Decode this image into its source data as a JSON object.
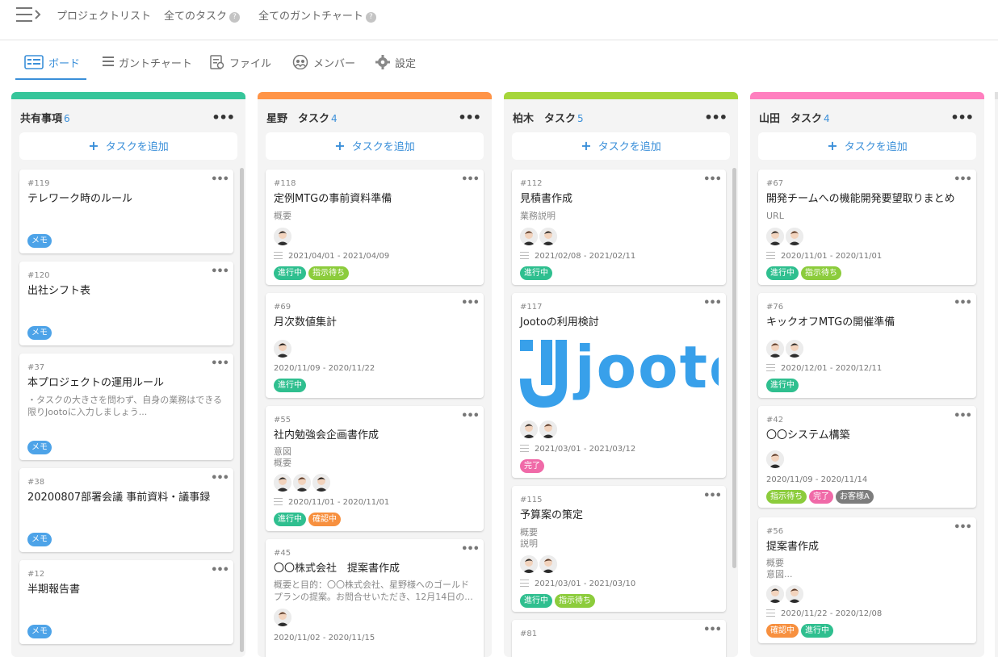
{
  "topnav": {
    "project_list": "プロジェクトリスト",
    "all_tasks": "全てのタスク",
    "all_gantt": "全てのガントチャート",
    "help_icon": "?"
  },
  "tabs": [
    {
      "label": "ボード",
      "active": true,
      "icon": "board-icon"
    },
    {
      "label": "ガントチャート",
      "icon": "gantt-icon"
    },
    {
      "label": "ファイル",
      "icon": "file-icon"
    },
    {
      "label": "メンバー",
      "icon": "member-icon"
    },
    {
      "label": "設定",
      "icon": "gear-icon"
    }
  ],
  "add_task_label": "タスクを追加",
  "more_label": "•••",
  "colors": {
    "accent": "#3a8fd9",
    "col1": "#36c59a",
    "col2": "#ff9447",
    "col3": "#a6d63a",
    "col4": "#ff7fbf"
  },
  "columns": [
    {
      "name": "共有事項",
      "count": "6",
      "cards": [
        {
          "id": "#119",
          "title": "テレワーク時のルール",
          "tags": [
            "メモ"
          ]
        },
        {
          "id": "#120",
          "title": "出社シフト表",
          "tags": [
            "メモ"
          ]
        },
        {
          "id": "#37",
          "title": "本プロジェクトの運用ルール",
          "desc1": "・タスクの大きさを問わず、自身の業務はできる",
          "desc2": "限りJootoに入力しましょう...",
          "tags": [
            "メモ"
          ]
        },
        {
          "id": "#38",
          "title": "20200807部署会議 事前資料・議事録",
          "tags": [
            "メモ"
          ]
        },
        {
          "id": "#12",
          "title": "半期報告書",
          "tags": [
            "メモ"
          ]
        }
      ]
    },
    {
      "name": "星野　タスク",
      "count": "4",
      "cards": [
        {
          "id": "#118",
          "title": "定例MTGの事前資料準備",
          "desc1": "概要",
          "date": "2021/04/01 - 2021/04/09",
          "tags": [
            "進行中",
            "指示待ち"
          ]
        },
        {
          "id": "#69",
          "title": "月次数値集計",
          "date": "2020/11/09 - 2020/11/22",
          "tags": [
            "進行中"
          ]
        },
        {
          "id": "#55",
          "title": "社内勉強会企画書作成",
          "desc1": "意図",
          "desc2": "概要",
          "date": "2020/11/01 - 2020/11/01",
          "tags": [
            "進行中",
            "確認中"
          ]
        },
        {
          "id": "#45",
          "title": "〇〇株式会社　提案書作成",
          "desc1": "概要と目的：〇〇株式会社、星野様へのゴールド",
          "desc2": "プランの提案。お問合せいただき、12月14日の...",
          "date": "2020/11/02 - 2020/11/15"
        }
      ]
    },
    {
      "name": "柏木　タスク",
      "count": "5",
      "cards": [
        {
          "id": "#112",
          "title": "見積書作成",
          "desc1": "業務説明",
          "date": "2021/02/08 - 2021/02/11",
          "tags": [
            "進行中"
          ]
        },
        {
          "id": "#117",
          "title": "Jootoの利用検討",
          "logo_text": "jooto",
          "date": "2021/03/01 - 2021/03/12",
          "tags": [
            "完了"
          ]
        },
        {
          "id": "#115",
          "title": "予算案の策定",
          "desc1": "概要",
          "desc2": "説明",
          "date": "2021/03/01 - 2021/03/10",
          "tags": [
            "進行中",
            "指示待ち"
          ]
        },
        {
          "id": "#81"
        }
      ]
    },
    {
      "name": "山田　タスク",
      "count": "4",
      "cards": [
        {
          "id": "#67",
          "title": "開発チームへの機能開発要望取りまとめ",
          "desc1": "URL",
          "date": "2020/11/01 - 2020/11/01",
          "tags": [
            "進行中",
            "指示待ち"
          ]
        },
        {
          "id": "#76",
          "title": "キックオフMTGの開催準備",
          "date": "2020/12/01 - 2020/12/11",
          "tags": [
            "進行中"
          ]
        },
        {
          "id": "#42",
          "title": "〇〇システム構築",
          "date": "2020/11/09 - 2020/11/14",
          "tags": [
            "指示待ち",
            "完了",
            "お客様A"
          ]
        },
        {
          "id": "#56",
          "title": "提案書作成",
          "desc1": "概要",
          "desc2": "意図...",
          "date": "2020/11/22 - 2020/12/08",
          "tags": [
            "確認中",
            "進行中"
          ]
        }
      ]
    }
  ]
}
